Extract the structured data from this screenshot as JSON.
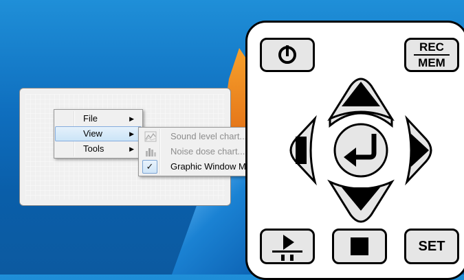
{
  "menu": {
    "items": [
      {
        "label": "File",
        "has_submenu": true
      },
      {
        "label": "View",
        "has_submenu": true,
        "active": true
      },
      {
        "label": "Tools",
        "has_submenu": true
      }
    ],
    "arrow_glyph": "▶"
  },
  "submenu": {
    "items": [
      {
        "label": "Sound level chart...",
        "enabled": false,
        "icon": "sound-level-chart-icon"
      },
      {
        "label": "Noise dose chart...",
        "enabled": false,
        "icon": "noise-dose-chart-icon"
      },
      {
        "label": "Graphic Window Mode",
        "enabled": true,
        "checked": true,
        "icon": "checkmark-icon"
      }
    ],
    "check_glyph": "✓"
  },
  "keypad": {
    "power_icon": "power-icon",
    "rec_label": "REC",
    "mem_label": "MEM",
    "set_label": "SET",
    "dpad": [
      "up-arrow",
      "down-arrow",
      "left-arrow",
      "right-arrow",
      "enter"
    ],
    "play_pause_icon": "play-pause-icon",
    "stop_icon": "stop-icon"
  }
}
